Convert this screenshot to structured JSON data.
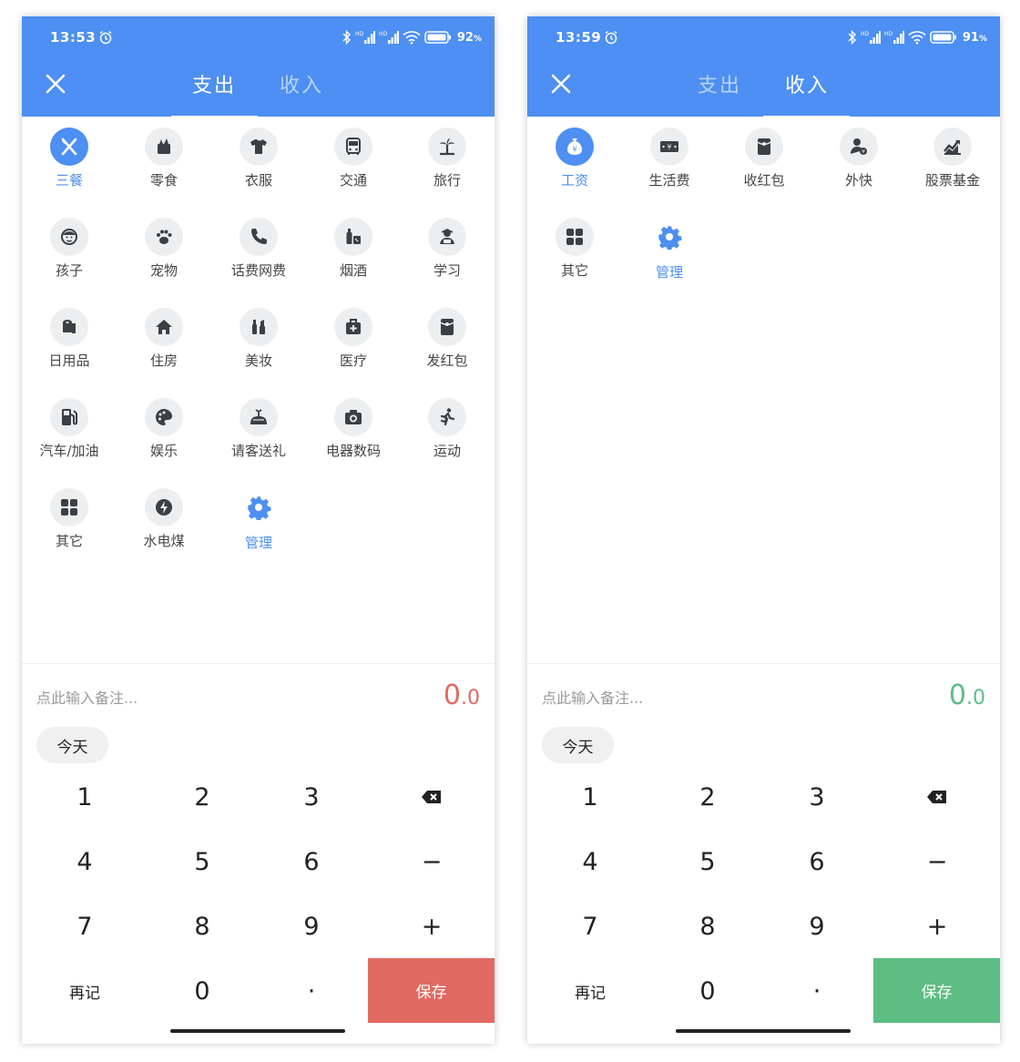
{
  "colors": {
    "header": "#4d8ff2",
    "selected": "#4d8ff2",
    "icon_gray": "#3c3f45",
    "expense_amount": "#e26a62",
    "income_amount": "#5cbd86",
    "expense_save": "#e16a63",
    "income_save": "#5dbd83"
  },
  "screens": [
    {
      "status": {
        "time": "13:53",
        "battery": "92"
      },
      "tabs": [
        {
          "label": "支出",
          "active": true
        },
        {
          "label": "收入",
          "active": false
        }
      ],
      "categories": [
        {
          "label": "三餐",
          "icon": "utensils-icon",
          "selected": true
        },
        {
          "label": "零食",
          "icon": "snack-icon"
        },
        {
          "label": "衣服",
          "icon": "shirt-icon"
        },
        {
          "label": "交通",
          "icon": "bus-icon"
        },
        {
          "label": "旅行",
          "icon": "palm-tree-icon"
        },
        {
          "label": "孩子",
          "icon": "child-face-icon"
        },
        {
          "label": "宠物",
          "icon": "paw-icon"
        },
        {
          "label": "话费网费",
          "icon": "phone-icon"
        },
        {
          "label": "烟酒",
          "icon": "bottle-icon"
        },
        {
          "label": "学习",
          "icon": "student-icon"
        },
        {
          "label": "日用品",
          "icon": "toilet-paper-icon"
        },
        {
          "label": "住房",
          "icon": "house-icon"
        },
        {
          "label": "美妆",
          "icon": "cosmetics-icon"
        },
        {
          "label": "医疗",
          "icon": "medical-kit-icon"
        },
        {
          "label": "发红包",
          "icon": "red-packet-icon"
        },
        {
          "label": "汽车/加油",
          "icon": "fuel-pump-icon"
        },
        {
          "label": "娱乐",
          "icon": "palette-icon"
        },
        {
          "label": "请客送礼",
          "icon": "gift-icon"
        },
        {
          "label": "电器数码",
          "icon": "camera-icon"
        },
        {
          "label": "运动",
          "icon": "running-icon"
        },
        {
          "label": "其它",
          "icon": "grid-icon"
        },
        {
          "label": "水电煤",
          "icon": "energy-icon"
        },
        {
          "label": "管理",
          "icon": "gear-icon",
          "manage": true
        }
      ],
      "note_placeholder": "点此输入备注...",
      "amount": {
        "int": "0",
        "dec": ".0"
      },
      "date_label": "今天",
      "keys": {
        "k1": "1",
        "k2": "2",
        "k3": "3",
        "k4": "4",
        "k5": "5",
        "k6": "6",
        "minus": "−",
        "k7": "7",
        "k8": "8",
        "k9": "9",
        "plus": "+",
        "again": "再记",
        "k0": "0",
        "dot": "·",
        "save": "保存"
      }
    },
    {
      "status": {
        "time": "13:59",
        "battery": "91"
      },
      "tabs": [
        {
          "label": "支出",
          "active": false
        },
        {
          "label": "收入",
          "active": true
        }
      ],
      "categories": [
        {
          "label": "工资",
          "icon": "money-bag-icon",
          "selected": true
        },
        {
          "label": "生活费",
          "icon": "cash-icon"
        },
        {
          "label": "收红包",
          "icon": "red-packet-icon"
        },
        {
          "label": "外快",
          "icon": "person-coin-icon"
        },
        {
          "label": "股票基金",
          "icon": "stock-chart-icon"
        },
        {
          "label": "其它",
          "icon": "grid-icon"
        },
        {
          "label": "管理",
          "icon": "gear-icon",
          "manage": true
        }
      ],
      "note_placeholder": "点此输入备注...",
      "amount": {
        "int": "0",
        "dec": ".0"
      },
      "date_label": "今天",
      "keys": {
        "k1": "1",
        "k2": "2",
        "k3": "3",
        "k4": "4",
        "k5": "5",
        "k6": "6",
        "minus": "−",
        "k7": "7",
        "k8": "8",
        "k9": "9",
        "plus": "+",
        "again": "再记",
        "k0": "0",
        "dot": "·",
        "save": "保存"
      }
    }
  ]
}
